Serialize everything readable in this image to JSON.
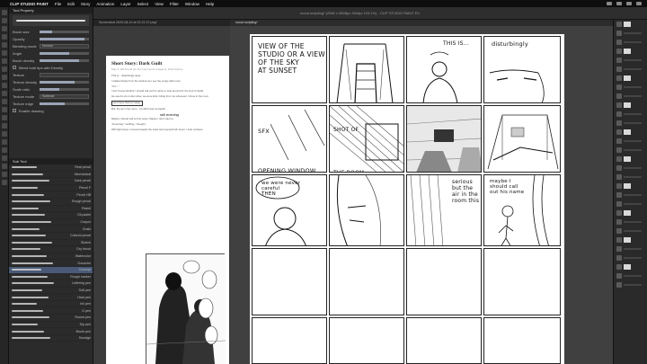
{
  "menubar": {
    "app_name": "CLIP STUDIO PAINT",
    "items": [
      "File",
      "Edit",
      "Story",
      "Animation",
      "Layer",
      "Select",
      "View",
      "Filter",
      "Window",
      "Help"
    ]
  },
  "window_title": "mood scripting* (2560 x 5608px 300dpi 103.1%) - CLIP STUDIO PAINT EX",
  "left_panel": {
    "tool_property_title": "Tool Property",
    "properties": [
      {
        "label": "Brush size",
        "fill": 0.25
      },
      {
        "label": "Opacity",
        "fill": 0.9
      }
    ],
    "blending_label": "Blending mode",
    "blending_value": "Normal",
    "angle_label": "Angle",
    "brush_density_label": "Brush density",
    "checks": [
      "Blend both tips with Density"
    ],
    "texture_label": "Texture",
    "texture_density_label": "Texture density",
    "scale_ratio_label": "Scale ratio",
    "texture_mode_label": "Texture mode",
    "texture_mode_value": "Subtract",
    "texture_edge_label": "Texture edge",
    "enable_check": "Enable drawing",
    "subtool_title": "Sub Tool",
    "subtools": [
      "Real pencil",
      "Mechanical",
      "Dark pencil",
      "Pencil F",
      "Pencil HB",
      "Rough pencil",
      "Pastel",
      "Oil pastel",
      "Crayon",
      "Chalk",
      "Colored pencil",
      "Sketch",
      "Dry brush",
      "Watercolor",
      "Gouache",
      "Concept",
      "Rough marker",
      "Lettering pen",
      "Soft pen",
      "Hard pen",
      "Ink pen",
      "G pen",
      "Round pen",
      "Dip pen",
      "Brush pen",
      "Smudge"
    ],
    "selected_subtool": 15
  },
  "doc1": {
    "tab": "Screenshot 2020-08-10 at 22.22.37.png*",
    "title": "Short Story: Dark Guilt",
    "meta": "May 3, 2015  9:42 pm  No Comments  Category: Dark Stories",
    "paragraphs": [
      "This is... disturbingly quiet...",
      "I walked slowly from the window as I see the empty dark room.",
      "\"Um...\"",
      "I don't know whether I should call out his name or look around for the God of death.",
      "He used to do it often when we were kids, hiding from me whenever I drove in the room.",
      "He'll have that fun today.",
      "But, the air in the room... he didn't feel so playful.",
      "Maybe I should call out his name. Maybe I don't want to.",
      "\"Good day,\" scoffing, I thought.",
      "With light steps I moved towards the towel and opened both doors. I look nowhere."
    ],
    "annotation": "still evening"
  },
  "doc2": {
    "tab": "mood scripting*",
    "panels": [
      {
        "text": "VIEW OF THE STUDIO OR A VIEW OF THE SKY\nAT SUNSET"
      },
      {
        "text": ""
      },
      {
        "text": "THIS IS..."
      },
      {
        "text": "disturbingly"
      },
      {
        "text": "SFX\nOPENING WINDOW"
      },
      {
        "text": "SHOT OF THE ROOM\nTV LIGHT"
      },
      {
        "text": ""
      },
      {
        "text": ""
      },
      {
        "text": "we were never careful\nTHEN"
      },
      {
        "text": ""
      },
      {
        "text": "serious but the air in the room this"
      },
      {
        "text": "maybe I should call out his name"
      }
    ]
  },
  "right_panel": {
    "rows": 30
  }
}
